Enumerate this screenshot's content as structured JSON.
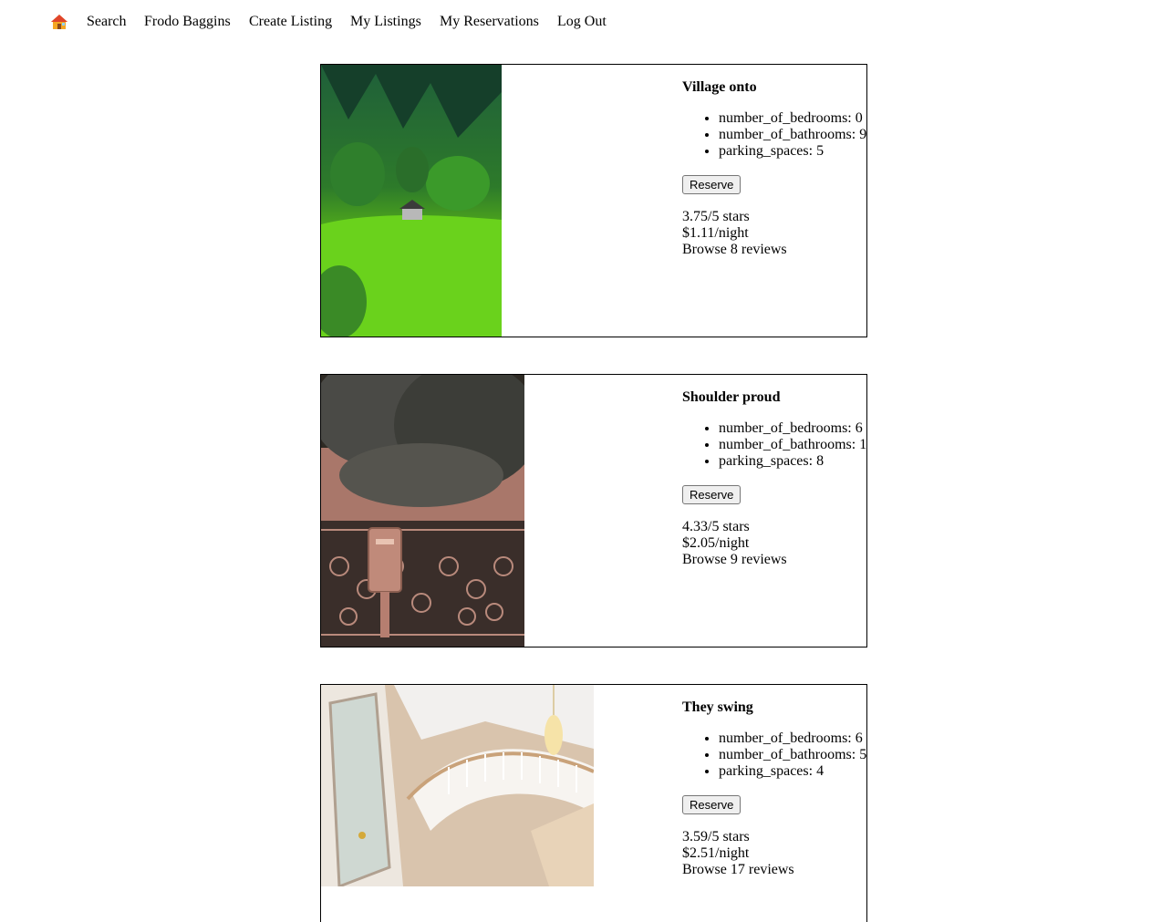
{
  "nav": {
    "home_icon": "house-icon",
    "links": [
      "Search",
      "Frodo Baggins",
      "Create Listing",
      "My Listings",
      "My Reservations",
      "Log Out"
    ]
  },
  "listings": [
    {
      "title": "Village onto",
      "features": [
        "number_of_bedrooms: 0",
        "number_of_bathrooms: 9",
        "parking_spaces: 5"
      ],
      "reserve_label": "Reserve",
      "rating": "3.75/5 stars",
      "price": "$1.11/night",
      "reviews": "Browse 8 reviews",
      "photo": "green-hillside-cabin-photo"
    },
    {
      "title": "Shoulder proud",
      "features": [
        "number_of_bedrooms: 6",
        "number_of_bathrooms: 1",
        "parking_spaces: 8"
      ],
      "reserve_label": "Reserve",
      "rating": "4.33/5 stars",
      "price": "$2.05/night",
      "reviews": "Browse 9 reviews",
      "photo": "ornate-gate-mailbox-photo"
    },
    {
      "title": "They swing",
      "features": [
        "number_of_bedrooms: 6",
        "number_of_bathrooms: 5",
        "parking_spaces: 4"
      ],
      "reserve_label": "Reserve",
      "rating": "3.59/5 stars",
      "price": "$2.51/night",
      "reviews": "Browse 17 reviews",
      "photo": "staircase-chandelier-photo"
    }
  ]
}
